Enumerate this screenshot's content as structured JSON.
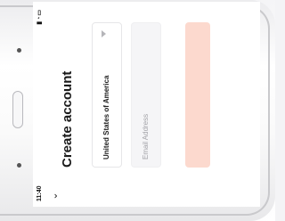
{
  "status_bar": {
    "time": "11:40",
    "icons": [
      "signal-icon",
      "wifi-icon",
      "battery-icon"
    ]
  },
  "header": {
    "back_icon": "chevron-down-icon",
    "title": "Create account"
  },
  "form": {
    "country_value": "United States of America",
    "email_placeholder": "Email Address"
  },
  "colors": {
    "submit_button": "#fcd9ce",
    "email_field_bg": "#f5f5f7"
  }
}
